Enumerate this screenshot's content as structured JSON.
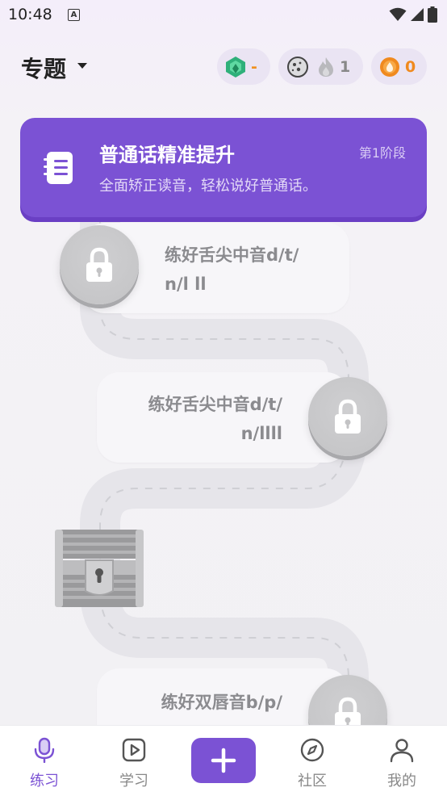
{
  "status_bar": {
    "time": "10:48",
    "notification_letter": "A"
  },
  "header": {
    "title": "专题",
    "gem_value": "-",
    "streak_value": "1",
    "coin_value": "0",
    "colors": {
      "gem": "#2fb07a",
      "gem_value": "#f0901e",
      "coin": "#f08a1e"
    }
  },
  "banner": {
    "title": "普通话精准提升",
    "subtitle": "全面矫正读音，轻松说好普通话。",
    "stage": "第1阶段",
    "color": "#7b52d4"
  },
  "lessons": [
    {
      "line1": "练好舌尖中音d/t/",
      "line2": "n/l ll"
    },
    {
      "line1": "练好舌尖中音d/t/",
      "line2": "n/llll"
    },
    {
      "line1": "练好双唇音b/p/",
      "line2": ""
    }
  ],
  "bottom_nav": {
    "items": [
      {
        "label": "练习",
        "icon": "microphone-icon",
        "active": true
      },
      {
        "label": "学习",
        "icon": "play-icon",
        "active": false
      },
      {
        "label": "社区",
        "icon": "compass-icon",
        "active": false
      },
      {
        "label": "我的",
        "icon": "person-icon",
        "active": false
      }
    ],
    "accent": "#7b52d4"
  }
}
